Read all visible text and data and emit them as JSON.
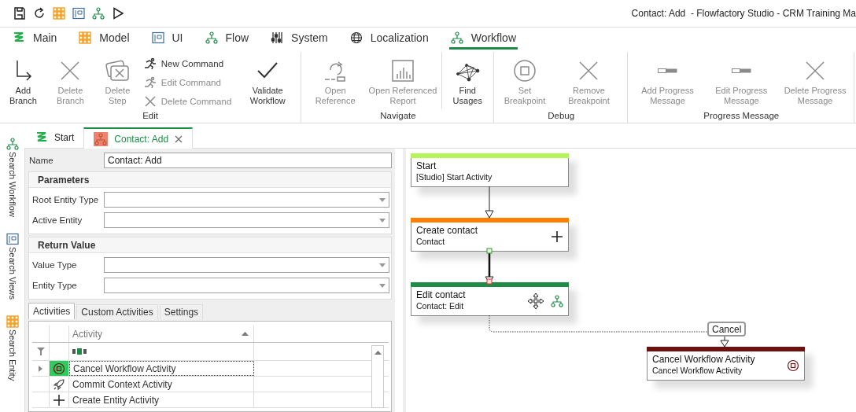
{
  "window": {
    "title": "Contact: Add  - Flowfactory Studio - CRM Training Ma"
  },
  "ribbon_tabs": [
    {
      "label": "Main",
      "selected": false
    },
    {
      "label": "Model",
      "selected": false
    },
    {
      "label": "UI",
      "selected": false
    },
    {
      "label": "Flow",
      "selected": false
    },
    {
      "label": "System",
      "selected": false
    },
    {
      "label": "Localization",
      "selected": false
    },
    {
      "label": "Workflow",
      "selected": true
    }
  ],
  "ribbon_groups": [
    {
      "label": "Edit",
      "sections": [
        [
          {
            "kind": "large",
            "label": "Add Branch",
            "disabled": false
          },
          {
            "kind": "large",
            "label": "Delete Branch",
            "disabled": true
          },
          {
            "kind": "large",
            "label": "Delete Step",
            "disabled": true
          },
          {
            "kind": "stack",
            "items": [
              {
                "label": "New Command",
                "disabled": false
              },
              {
                "label": "Edit Command",
                "disabled": true
              },
              {
                "label": "Delete Command",
                "disabled": true
              }
            ]
          },
          {
            "kind": "large",
            "label": "Validate Workflow",
            "disabled": false
          }
        ]
      ]
    },
    {
      "label": "Navigate",
      "sections": [
        [
          {
            "kind": "large",
            "label": "Open Reference",
            "disabled": true
          },
          {
            "kind": "large",
            "label": "Open Referenced Report",
            "disabled": true
          }
        ],
        [
          {
            "kind": "large",
            "label": "Find Usages",
            "disabled": false
          }
        ]
      ]
    },
    {
      "label": "Debug",
      "sections": [
        [
          {
            "kind": "large",
            "label": "Set Breakpoint",
            "disabled": true
          },
          {
            "kind": "large",
            "label": "Remove Breakpoint",
            "disabled": true
          }
        ]
      ]
    },
    {
      "label": "Progress Message",
      "sections": [
        [
          {
            "kind": "large",
            "label": "Add Progress Message",
            "disabled": true
          },
          {
            "kind": "large",
            "label": "Edit Progress Message",
            "disabled": true
          },
          {
            "kind": "large",
            "label": "Delete Progress Message",
            "disabled": true
          }
        ]
      ]
    }
  ],
  "sidebar": {
    "items": [
      {
        "label": "Search Workflow"
      },
      {
        "label": "Search Views"
      },
      {
        "label": "Search Entity"
      }
    ]
  },
  "document_tabs": [
    {
      "label": "Start",
      "selected": false
    },
    {
      "label": "Contact: Add",
      "selected": true
    }
  ],
  "properties": {
    "name_label": "Name",
    "name_value": "Contact: Add",
    "groups": [
      {
        "title": "Parameters",
        "fields": [
          {
            "label": "Root Entity Type"
          },
          {
            "label": "Active Entity"
          }
        ]
      },
      {
        "title": "Return Value",
        "fields": [
          {
            "label": "Value Type"
          },
          {
            "label": "Entity Type"
          }
        ]
      }
    ]
  },
  "bottom_tabs": [
    {
      "label": "Activities",
      "selected": true
    },
    {
      "label": "Custom Activities",
      "selected": false
    },
    {
      "label": "Settings",
      "selected": false
    }
  ],
  "activity_table": {
    "column": "Activity",
    "rows": [
      {
        "name": "Cancel Workflow Activity",
        "selected": true
      },
      {
        "name": "Commit Context Activity",
        "selected": false
      },
      {
        "name": "Create Entity Activity",
        "selected": false
      }
    ]
  },
  "workflow": {
    "nodes": [
      {
        "kind": "start",
        "title": "Start",
        "subtitle": "[Studio] Start Activity",
        "color": "#b5f55a"
      },
      {
        "kind": "create",
        "title": "Create contact",
        "subtitle": "Contact",
        "color": "#ff8000"
      },
      {
        "kind": "subflow",
        "title": "Edit contact",
        "subtitle": "Contact: Edit",
        "color": "#1e8c46"
      },
      {
        "kind": "cancel",
        "title": "Cancel Workflow Activity",
        "subtitle": "Cancel Workflow Activity",
        "color": "#6e1010"
      }
    ],
    "branch_label": "Cancel"
  }
}
